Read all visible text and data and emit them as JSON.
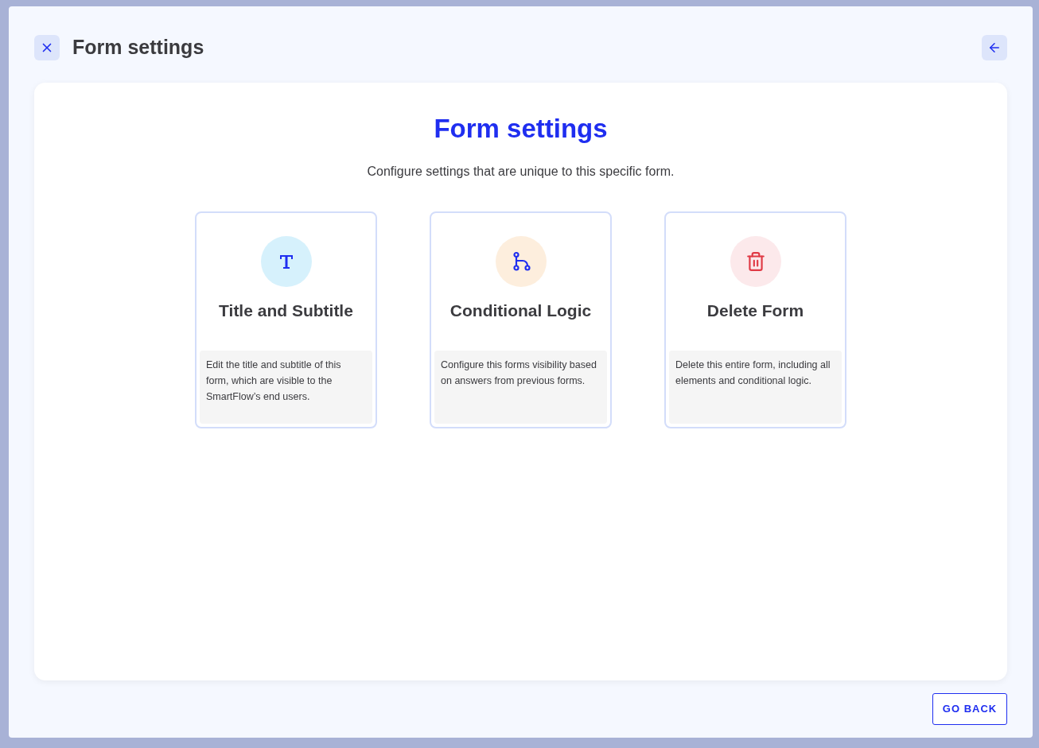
{
  "header": {
    "title": "Form settings"
  },
  "main": {
    "heading": "Form settings",
    "subtitle": "Configure settings that are unique to this specific form."
  },
  "cards": [
    {
      "kind": "text",
      "color": "#d6f1fc",
      "title": "Title and Subtitle",
      "description": "Edit the title and subtitle of this form, which are visible to the SmartFlow’s end users."
    },
    {
      "kind": "logic",
      "color": "#fdeedd",
      "title": "Conditional Logic",
      "description": "Configure this forms visibility based on answers from previous forms."
    },
    {
      "kind": "delete",
      "color": "#fce9eb",
      "title": "Delete Form",
      "description": "Delete this entire form, including all elements and conditional logic."
    }
  ],
  "footer": {
    "button": "GO BACK"
  }
}
